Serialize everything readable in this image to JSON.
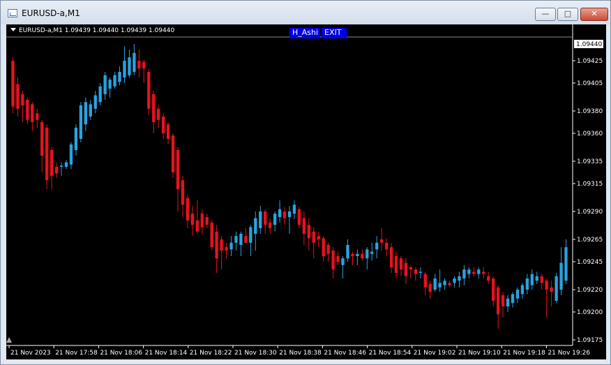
{
  "window": {
    "title": "EURUSD-a,M1",
    "min_glyph": "—",
    "max_glyph": "□",
    "close_glyph": "✕"
  },
  "chart_header": {
    "text": "EURUSD-a,M1  1.09439 1.09440 1.09439 1.09440"
  },
  "buttons": {
    "hashi": "H_Ashi",
    "exit": "EXIT"
  },
  "colors": {
    "background": "#000000",
    "bull": "#29a3e0",
    "bear": "#e8111f",
    "axis": "#ffffff",
    "button_bg": "#0000e6"
  },
  "chart_data": {
    "type": "candlestick",
    "symbol": "EURUSD-a",
    "timeframe": "M1",
    "ylim": [
      1.0917,
      1.09445
    ],
    "current_price": 1.0944,
    "y_ticks": [
      1.09425,
      1.09405,
      1.0938,
      1.0936,
      1.09335,
      1.09315,
      1.0929,
      1.09265,
      1.09245,
      1.0922,
      1.092,
      1.09175
    ],
    "y_tick_labels": [
      "1.09425",
      "1.09405",
      "1.09380",
      "1.09360",
      "1.09335",
      "1.09315",
      "1.09290",
      "1.09265",
      "1.09245",
      "1.09220",
      "1.09200",
      "1.09175"
    ],
    "current_price_label": "1.09440",
    "x_tick_labels": [
      "21 Nov 2023",
      "21 Nov 17:58",
      "21 Nov 18:06",
      "21 Nov 18:14",
      "21 Nov 18:22",
      "21 Nov 18:30",
      "21 Nov 18:38",
      "21 Nov 18:46",
      "21 Nov 18:54",
      "21 Nov 19:02",
      "21 Nov 19:10",
      "21 Nov 19:18",
      "21 Nov 19:26"
    ],
    "candles": [
      [
        1.09425,
        1.09428,
        1.09378,
        1.09384
      ],
      [
        1.09404,
        1.0941,
        1.09375,
        1.09382
      ],
      [
        1.09395,
        1.09398,
        1.0937,
        1.09385
      ],
      [
        1.0939,
        1.09392,
        1.09368,
        1.09372
      ],
      [
        1.09386,
        1.09388,
        1.09362,
        1.0937
      ],
      [
        1.09378,
        1.09382,
        1.09365,
        1.09372
      ],
      [
        1.0937,
        1.09372,
        1.09325,
        1.0934
      ],
      [
        1.09365,
        1.09368,
        1.0931,
        1.09318
      ],
      [
        1.09345,
        1.09348,
        1.0931,
        1.09322
      ],
      [
        1.0933,
        1.09334,
        1.0932,
        1.09324
      ],
      [
        1.0933,
        1.09334,
        1.09322,
        1.09331
      ],
      [
        1.0933,
        1.09336,
        1.09328,
        1.09334
      ],
      [
        1.09332,
        1.09352,
        1.09328,
        1.0935
      ],
      [
        1.09345,
        1.09368,
        1.0934,
        1.09365
      ],
      [
        1.09355,
        1.09388,
        1.09352,
        1.09385
      ],
      [
        1.09368,
        1.09392,
        1.09362,
        1.09388
      ],
      [
        1.09375,
        1.0939,
        1.09372,
        1.09386
      ],
      [
        1.09382,
        1.09398,
        1.09378,
        1.09394
      ],
      [
        1.09388,
        1.09405,
        1.09385,
        1.09402
      ],
      [
        1.09395,
        1.09415,
        1.0939,
        1.09412
      ],
      [
        1.094,
        1.0941,
        1.09392,
        1.09408
      ],
      [
        1.09402,
        1.09415,
        1.094,
        1.09412
      ],
      [
        1.09406,
        1.0942,
        1.09403,
        1.09415
      ],
      [
        1.0941,
        1.09438,
        1.09405,
        1.09425
      ],
      [
        1.09412,
        1.09435,
        1.0941,
        1.09428
      ],
      [
        1.09415,
        1.0944,
        1.09412,
        1.09432
      ],
      [
        1.09425,
        1.09435,
        1.0941,
        1.09418
      ],
      [
        1.09424,
        1.09426,
        1.09405,
        1.09418
      ],
      [
        1.09415,
        1.09418,
        1.09376,
        1.09382
      ],
      [
        1.09395,
        1.09398,
        1.0936,
        1.0937
      ],
      [
        1.09382,
        1.09385,
        1.09365,
        1.09372
      ],
      [
        1.09375,
        1.09378,
        1.09355,
        1.0936
      ],
      [
        1.09368,
        1.0937,
        1.0935,
        1.09355
      ],
      [
        1.09358,
        1.0936,
        1.0932,
        1.09325
      ],
      [
        1.09345,
        1.09348,
        1.0929,
        1.0931
      ],
      [
        1.09318,
        1.09322,
        1.09285,
        1.09296
      ],
      [
        1.09302,
        1.09305,
        1.09275,
        1.09282
      ],
      [
        1.09288,
        1.09295,
        1.09268,
        1.09278
      ],
      [
        1.09282,
        1.093,
        1.0927,
        1.09272
      ],
      [
        1.09288,
        1.09292,
        1.0927,
        1.09276
      ],
      [
        1.09285,
        1.09288,
        1.09275,
        1.09278
      ],
      [
        1.0928,
        1.09282,
        1.09255,
        1.09258
      ],
      [
        1.09272,
        1.09278,
        1.09235,
        1.09248
      ],
      [
        1.09265,
        1.09268,
        1.09238,
        1.09255
      ],
      [
        1.09258,
        1.09262,
        1.09248,
        1.09255
      ],
      [
        1.09256,
        1.09268,
        1.0925,
        1.09262
      ],
      [
        1.09262,
        1.09272,
        1.09255,
        1.09268
      ],
      [
        1.0926,
        1.09272,
        1.0925,
        1.0927
      ],
      [
        1.09268,
        1.09275,
        1.09262,
        1.09262
      ],
      [
        1.09262,
        1.09278,
        1.0925,
        1.09276
      ],
      [
        1.0927,
        1.0929,
        1.09255,
        1.09284
      ],
      [
        1.09275,
        1.09295,
        1.0927,
        1.0929
      ],
      [
        1.0929,
        1.09292,
        1.0927,
        1.09278
      ],
      [
        1.0928,
        1.09284,
        1.0927,
        1.09275
      ],
      [
        1.09278,
        1.0929,
        1.09272,
        1.09288
      ],
      [
        1.09285,
        1.093,
        1.0928,
        1.09292
      ],
      [
        1.0929,
        1.09294,
        1.09278,
        1.09284
      ],
      [
        1.09285,
        1.09295,
        1.0927,
        1.0929
      ],
      [
        1.09288,
        1.093,
        1.09283,
        1.09296
      ],
      [
        1.09292,
        1.09294,
        1.09275,
        1.09278
      ],
      [
        1.09284,
        1.0929,
        1.0926,
        1.0927
      ],
      [
        1.09278,
        1.09284,
        1.09255,
        1.09266
      ],
      [
        1.09272,
        1.09276,
        1.09248,
        1.09262
      ],
      [
        1.09268,
        1.09272,
        1.09258,
        1.09265
      ],
      [
        1.09266,
        1.09268,
        1.09245,
        1.0925
      ],
      [
        1.0926,
        1.09262,
        1.09245,
        1.09252
      ],
      [
        1.09255,
        1.09258,
        1.0923,
        1.09238
      ],
      [
        1.0925,
        1.09254,
        1.09242,
        1.09245
      ],
      [
        1.09242,
        1.0925,
        1.0923,
        1.09248
      ],
      [
        1.09248,
        1.09265,
        1.09245,
        1.0926
      ],
      [
        1.09252,
        1.09254,
        1.09242,
        1.0925
      ],
      [
        1.0925,
        1.09256,
        1.09242,
        1.09252
      ],
      [
        1.09252,
        1.09256,
        1.09246,
        1.09248
      ],
      [
        1.09248,
        1.09258,
        1.09238,
        1.09256
      ],
      [
        1.09252,
        1.09262,
        1.09246,
        1.09254
      ],
      [
        1.09256,
        1.09268,
        1.09248,
        1.09262
      ],
      [
        1.09265,
        1.09275,
        1.09255,
        1.09262
      ],
      [
        1.09262,
        1.09266,
        1.0925,
        1.09256
      ],
      [
        1.09258,
        1.09262,
        1.09235,
        1.0924
      ],
      [
        1.0925,
        1.09254,
        1.0923,
        1.09235
      ],
      [
        1.09248,
        1.0925,
        1.09232,
        1.09238
      ],
      [
        1.09244,
        1.09248,
        1.09225,
        1.09232
      ],
      [
        1.0924,
        1.09242,
        1.0923,
        1.09238
      ],
      [
        1.09238,
        1.0924,
        1.09228,
        1.09234
      ],
      [
        1.09236,
        1.0924,
        1.0923,
        1.09236
      ],
      [
        1.09234,
        1.09236,
        1.09215,
        1.09222
      ],
      [
        1.09225,
        1.09228,
        1.09212,
        1.09218
      ],
      [
        1.0922,
        1.09234,
        1.09218,
        1.0923
      ],
      [
        1.09222,
        1.09238,
        1.09218,
        1.09226
      ],
      [
        1.09224,
        1.0923,
        1.0922,
        1.09228
      ],
      [
        1.09226,
        1.09228,
        1.09222,
        1.09224
      ],
      [
        1.09226,
        1.09232,
        1.09222,
        1.0923
      ],
      [
        1.09228,
        1.09236,
        1.09222,
        1.09232
      ],
      [
        1.0923,
        1.09242,
        1.09224,
        1.09238
      ],
      [
        1.09234,
        1.0924,
        1.0923,
        1.09238
      ],
      [
        1.09236,
        1.0924,
        1.09232,
        1.09234
      ],
      [
        1.09234,
        1.0924,
        1.0923,
        1.09238
      ],
      [
        1.09236,
        1.0924,
        1.0923,
        1.09234
      ],
      [
        1.09232,
        1.09236,
        1.09225,
        1.09228
      ],
      [
        1.0923,
        1.09232,
        1.09205,
        1.0921
      ],
      [
        1.09222,
        1.09224,
        1.09185,
        1.09198
      ],
      [
        1.09215,
        1.09218,
        1.09195,
        1.09205
      ],
      [
        1.09205,
        1.09215,
        1.092,
        1.09212
      ],
      [
        1.09208,
        1.09218,
        1.09204,
        1.09216
      ],
      [
        1.09212,
        1.09222,
        1.09208,
        1.0922
      ],
      [
        1.09216,
        1.09226,
        1.09212,
        1.09224
      ],
      [
        1.0922,
        1.09234,
        1.09216,
        1.0923
      ],
      [
        1.09224,
        1.09238,
        1.0922,
        1.09234
      ],
      [
        1.09228,
        1.09236,
        1.09225,
        1.09232
      ],
      [
        1.09232,
        1.09234,
        1.0922,
        1.09226
      ],
      [
        1.09228,
        1.0923,
        1.09195,
        1.0922
      ],
      [
        1.09222,
        1.09228,
        1.09205,
        1.09218
      ],
      [
        1.0921,
        1.09235,
        1.09208,
        1.09232
      ],
      [
        1.0922,
        1.09258,
        1.09215,
        1.09244
      ],
      [
        1.09228,
        1.09265,
        1.09225,
        1.09258
      ]
    ]
  }
}
